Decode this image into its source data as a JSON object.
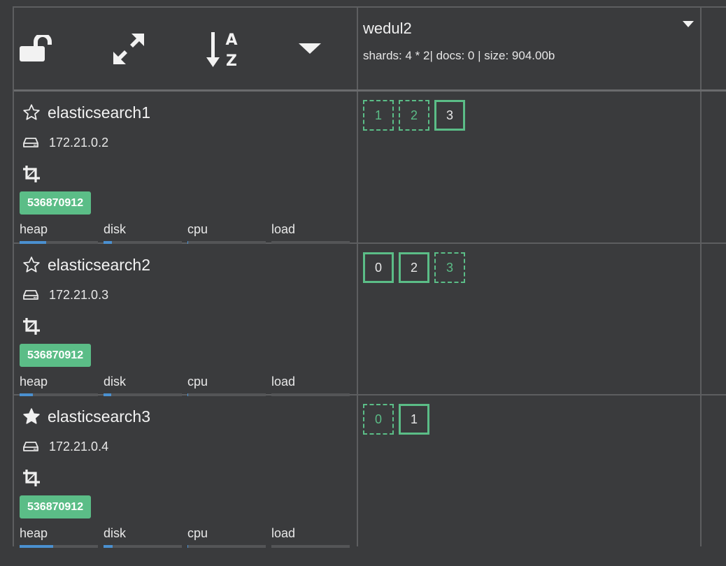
{
  "toolbar": {
    "lock_icon": "unlock-icon",
    "expand_icon": "expand-arrows-icon",
    "sort_icon": "sort-alpha-icon",
    "menu_icon": "caret-down-icon"
  },
  "index": {
    "name": "wedul2",
    "stats": "shards: 4 * 2| docs: 0 | size: 904.00b"
  },
  "colors": {
    "background": "#3a3b3d",
    "grid_line": "#5d5e60",
    "accent_green": "#5bbd87",
    "metric_bar": "#4a90d0"
  },
  "metric_labels": [
    "heap",
    "disk",
    "cpu",
    "load"
  ],
  "nodes": [
    {
      "name": "elasticsearch1",
      "master": false,
      "ip": "172.21.0.2",
      "badge": "536870912",
      "metrics": {
        "heap": 0.34,
        "disk": 0.11,
        "cpu": 0.01,
        "load": 0.0
      },
      "shards": [
        {
          "label": "1",
          "kind": "replica"
        },
        {
          "label": "2",
          "kind": "replica"
        },
        {
          "label": "3",
          "kind": "primary"
        }
      ]
    },
    {
      "name": "elasticsearch2",
      "master": false,
      "ip": "172.21.0.3",
      "badge": "536870912",
      "metrics": {
        "heap": 0.17,
        "disk": 0.1,
        "cpu": 0.01,
        "load": 0.0
      },
      "shards": [
        {
          "label": "0",
          "kind": "primary"
        },
        {
          "label": "2",
          "kind": "primary"
        },
        {
          "label": "3",
          "kind": "replica"
        }
      ]
    },
    {
      "name": "elasticsearch3",
      "master": true,
      "ip": "172.21.0.4",
      "badge": "536870912",
      "metrics": {
        "heap": 0.43,
        "disk": 0.12,
        "cpu": 0.01,
        "load": 0.0
      },
      "shards": [
        {
          "label": "0",
          "kind": "replica"
        },
        {
          "label": "1",
          "kind": "primary"
        }
      ]
    }
  ]
}
